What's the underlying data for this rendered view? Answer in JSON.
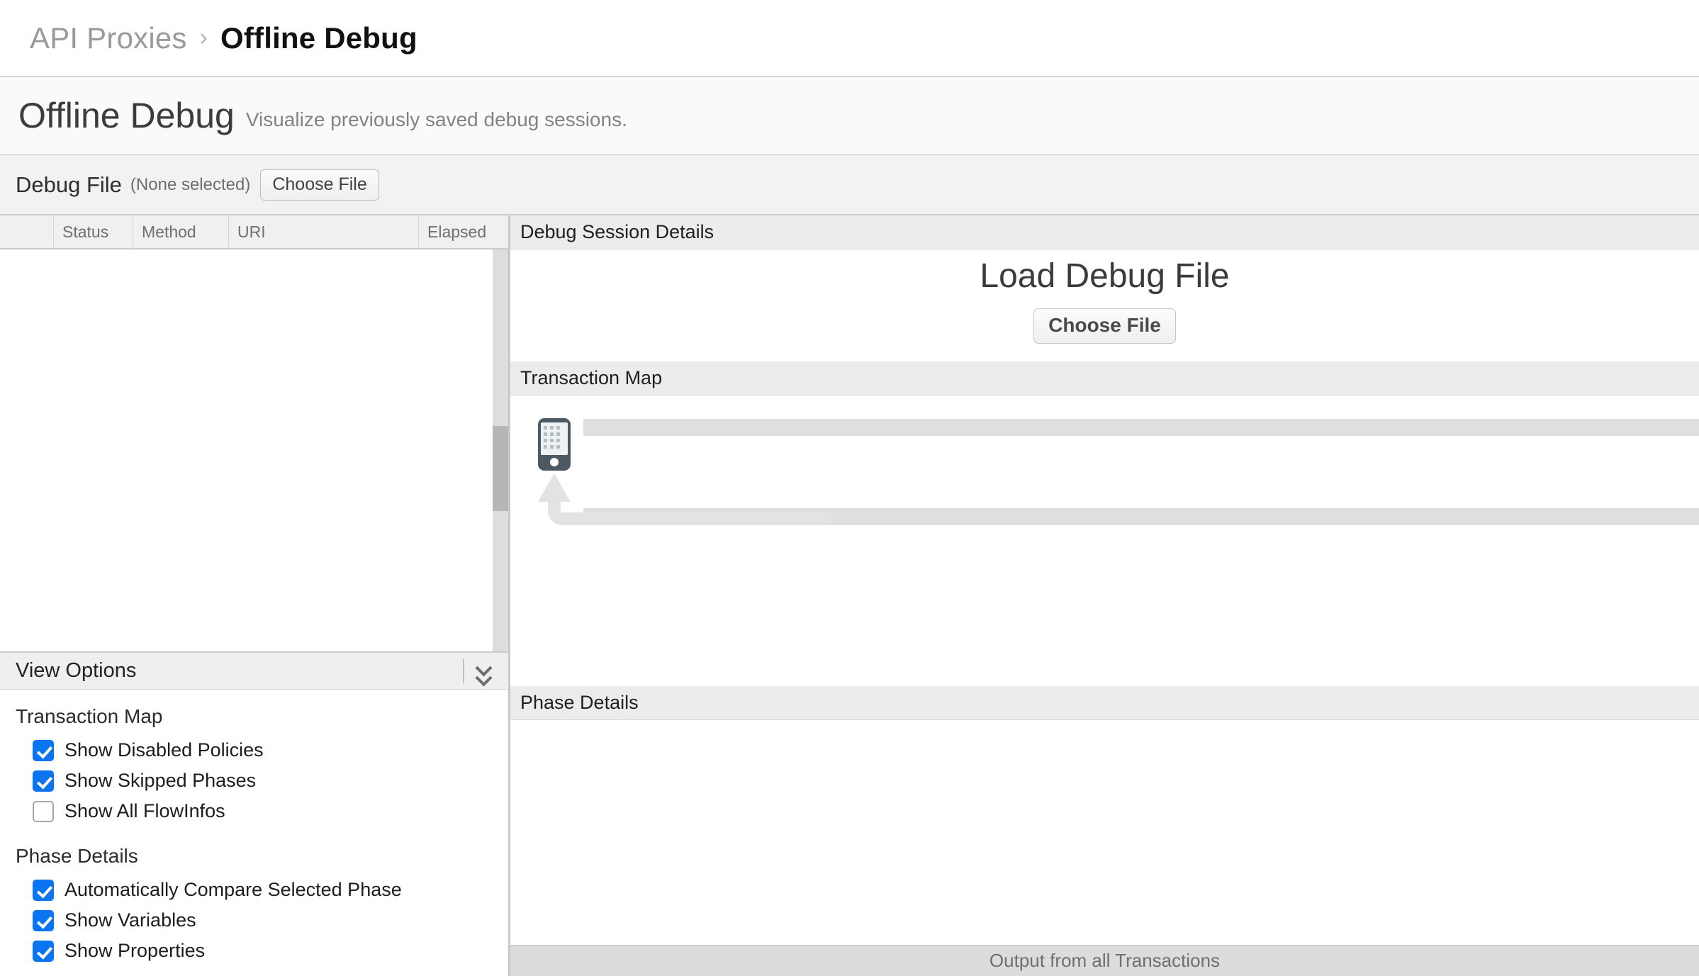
{
  "breadcrumb": {
    "parent": "API Proxies",
    "separator": "›",
    "current": "Offline Debug"
  },
  "page": {
    "title": "Offline Debug",
    "subtitle": "Visualize previously saved debug sessions."
  },
  "file_bar": {
    "label": "Debug File",
    "status": "(None selected)",
    "choose_button": "Choose File"
  },
  "transactions_table": {
    "columns": [
      "",
      "Status",
      "Method",
      "URI",
      "Elapsed"
    ],
    "rows": []
  },
  "view_options": {
    "title": "View Options",
    "collapse_icon": "chevron-double-down-icon",
    "groups": [
      {
        "title": "Transaction Map",
        "items": [
          {
            "label": "Show Disabled Policies",
            "checked": true
          },
          {
            "label": "Show Skipped Phases",
            "checked": true
          },
          {
            "label": "Show All FlowInfos",
            "checked": false
          }
        ]
      },
      {
        "title": "Phase Details",
        "items": [
          {
            "label": "Automatically Compare Selected Phase",
            "checked": true
          },
          {
            "label": "Show Variables",
            "checked": true
          },
          {
            "label": "Show Properties",
            "checked": true
          }
        ]
      }
    ]
  },
  "session_details": {
    "header": "Debug Session Details",
    "load_title": "Load Debug File",
    "choose_button": "Choose File"
  },
  "transaction_map": {
    "header": "Transaction Map",
    "client_icon": "mobile-phone-icon",
    "request_flow_label": "",
    "response_flow_label": ""
  },
  "phase_details": {
    "header": "Phase Details"
  },
  "footer": {
    "text": "Output from all Transactions"
  },
  "colors": {
    "checkbox_accent": "#0b74f0",
    "panel_header_bg": "#ececec",
    "flow_bar": "#dfdfdf",
    "phone_body": "#4c5862"
  }
}
